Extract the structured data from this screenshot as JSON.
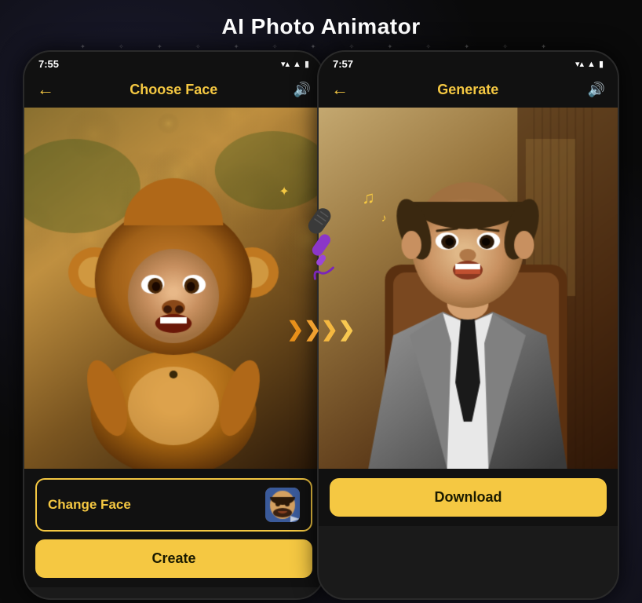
{
  "page": {
    "title": "AI Photo Animator",
    "bg_color": "#0a0a0a"
  },
  "left_phone": {
    "status_time": "7:55",
    "nav_title": "Choose Face",
    "nav_back": "←",
    "nav_sound": "🔊",
    "change_face_label": "Change Face",
    "create_button_label": "Create"
  },
  "right_phone": {
    "status_time": "7:57",
    "nav_title": "Generate",
    "nav_back": "←",
    "nav_sound": "🔊",
    "download_button_label": "Download"
  },
  "icons": {
    "back_arrow": "←",
    "sound": "🔊",
    "sparkle": "✦",
    "music_note": "♪",
    "music_note2": "♫",
    "chevron": "❯"
  }
}
